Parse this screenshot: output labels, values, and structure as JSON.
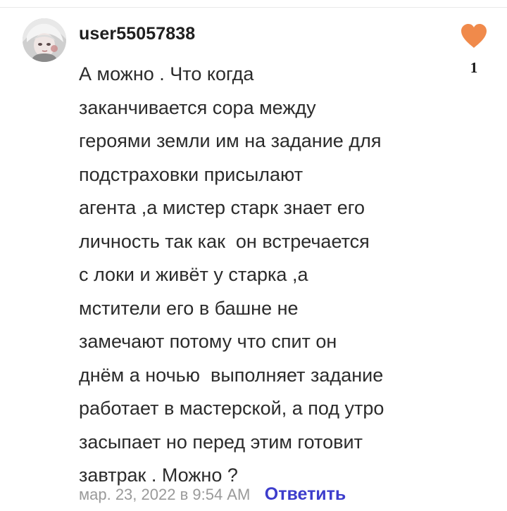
{
  "comment": {
    "username": "user55057838",
    "avatar_icon": "user-avatar-anime-icon",
    "text_lines": [
      "А можно . Что когда",
      "заканчивается сора между",
      "героями земли им на задание для",
      "подстраховки присылают",
      "агента ,а мистер старк знает его",
      "личность так как  он встречается",
      "с локи и живёт у старка ,а",
      "мстители его в башне не",
      "замечают потому что спит он",
      "днём а ночью  выполняет задание",
      "работает в мастерской, а под утро",
      "засыпает но перед этим готовит",
      "завтрак . Можно ?"
    ],
    "timestamp": "мар. 23, 2022 в 9:54 AM",
    "reply_label": "Ответить",
    "likes": {
      "icon": "heart-icon",
      "count": "1"
    }
  },
  "colors": {
    "heart": "#f08a4b",
    "reply_link": "#3d3dcc",
    "timestamp": "#9a9a9a",
    "text": "#2b2b2b"
  }
}
